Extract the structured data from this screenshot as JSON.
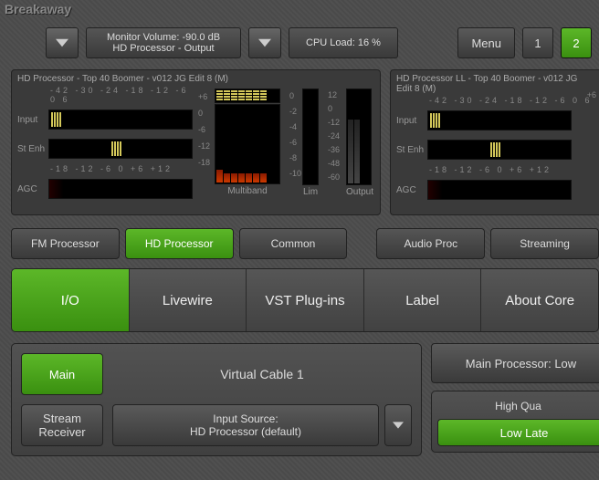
{
  "app_title": "Breakaway",
  "header": {
    "monitor_line1": "Monitor Volume: -90.0 dB",
    "monitor_line2": "HD Processor - Output",
    "cpu_load": "CPU Load: 16 %",
    "menu": "Menu",
    "page1": "1",
    "page2": "2"
  },
  "meters": {
    "left": {
      "preset": "HD Processor - Top 40 Boomer - v012 JG Edit 8 (M)",
      "ticks_input": "-42 -30 -24 -18 -12 -6  0  6",
      "label_input": "Input",
      "label_stenh": "St Enh",
      "ticks_agc": "-18  -12   -6    0   +6  +12",
      "label_agc": "AGC",
      "mb_ticks": [
        "+6",
        "0",
        "-6",
        "-12",
        "-18"
      ],
      "lim_ticks": [
        "0",
        "-2",
        "-4",
        "-6",
        "-8",
        "-10"
      ],
      "out_ticks": [
        "12",
        "0",
        "-12",
        "-24",
        "-36",
        "-48",
        "-60"
      ],
      "cap_mb": "Multiband",
      "cap_lim": "Lim",
      "cap_out": "Output"
    },
    "right": {
      "preset": "HD Processor LL - Top 40 Boomer - v012 JG Edit 8 (M)",
      "ticks_input": "-42 -30 -24 -18 -12 -6  0  6",
      "label_input": "Input",
      "label_stenh": "St Enh",
      "ticks_agc": "-18  -12   -6    0   +6  +12",
      "label_agc": "AGC",
      "mb_tick": "+6"
    }
  },
  "tabs1": {
    "fm": "FM Processor",
    "hd": "HD Processor",
    "common": "Common",
    "audio": "Audio Proc",
    "stream": "Streaming"
  },
  "tabs2": {
    "io": "I/O",
    "livewire": "Livewire",
    "vst": "VST Plug-ins",
    "label": "Label",
    "about": "About Core"
  },
  "lower": {
    "main": "Main",
    "stream1": "Stream",
    "stream2": "Receiver",
    "vc": "Virtual Cable 1",
    "src1": "Input Source:",
    "src2": "HD Processor (default)",
    "mainproc": "Main Processor: Low",
    "hq": "High Qua",
    "ll": "Low Late"
  }
}
